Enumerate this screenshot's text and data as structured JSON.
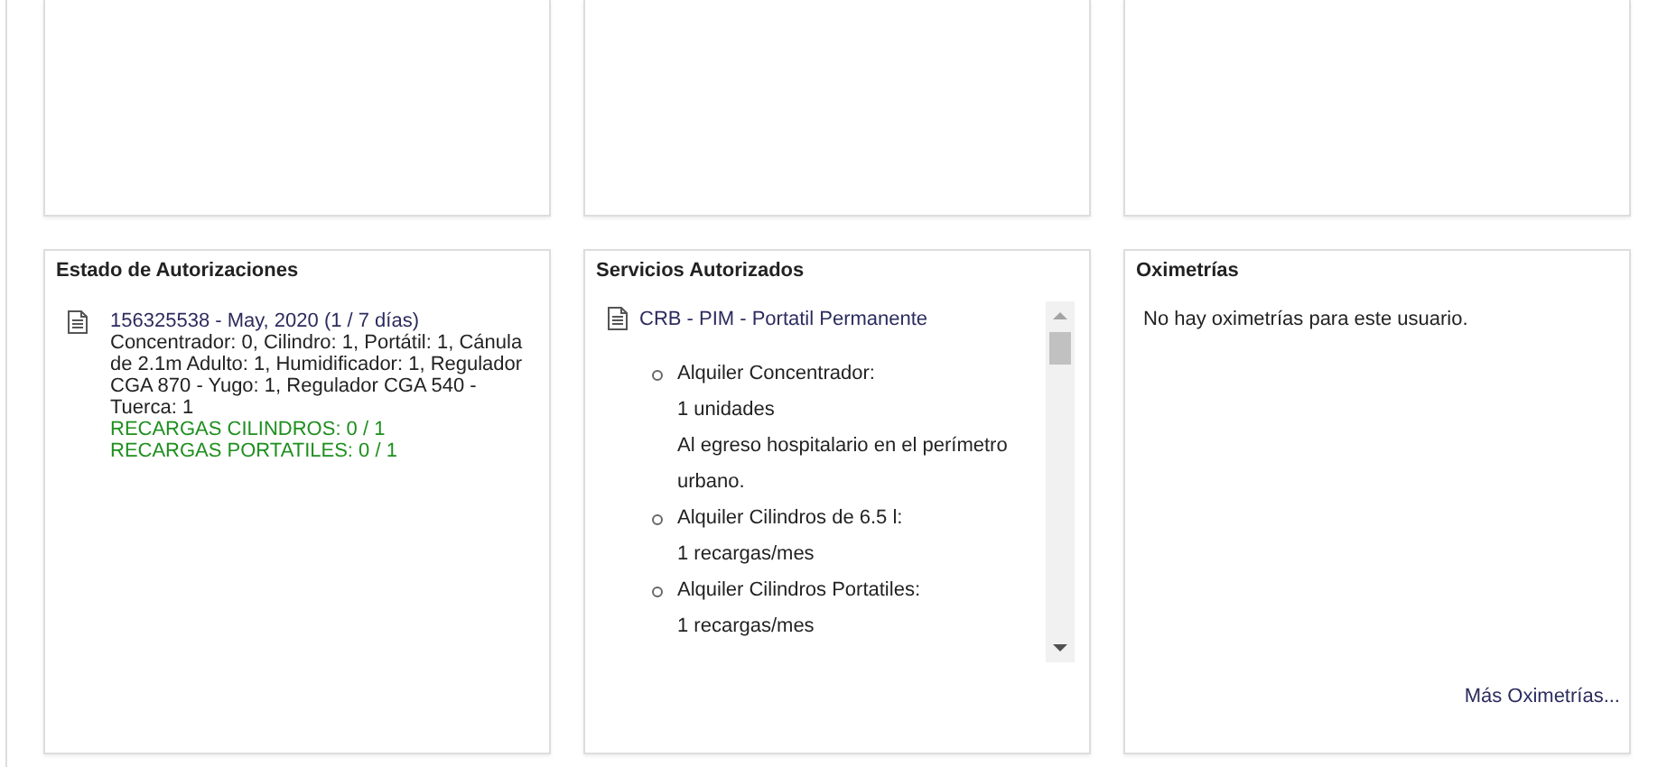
{
  "authorizations": {
    "title": "Estado de Autorizaciones",
    "entries": [
      {
        "header": "156325538 - May, 2020 (1 / 7 días)",
        "detail": "Concentrador: 0, Cilindro: 1, Portátil: 1, Cánula de 2.1m Adulto: 1, Humidificador: 1, Regulador CGA 870 - Yugo: 1, Regulador CGA 540 - Tuerca: 1",
        "recharges": [
          "RECARGAS CILINDROS: 0 / 1",
          "RECARGAS PORTATILES: 0 / 1"
        ]
      }
    ]
  },
  "services": {
    "title": "Servicios Autorizados",
    "plan": "CRB - PIM - Portatil Permanente",
    "items": [
      {
        "name": "Alquiler Concentrador:",
        "lines": [
          "1 unidades",
          "Al egreso hospitalario en el perímetro urbano."
        ]
      },
      {
        "name": "Alquiler Cilindros de 6.5 l:",
        "lines": [
          "1 recargas/mes"
        ]
      },
      {
        "name": "Alquiler Cilindros Portatiles:",
        "lines": [
          "1 recargas/mes"
        ]
      }
    ]
  },
  "oximetries": {
    "title": "Oximetrías",
    "message": "No hay oximetrías para este usuario.",
    "more_link": "Más Oximetrías..."
  }
}
